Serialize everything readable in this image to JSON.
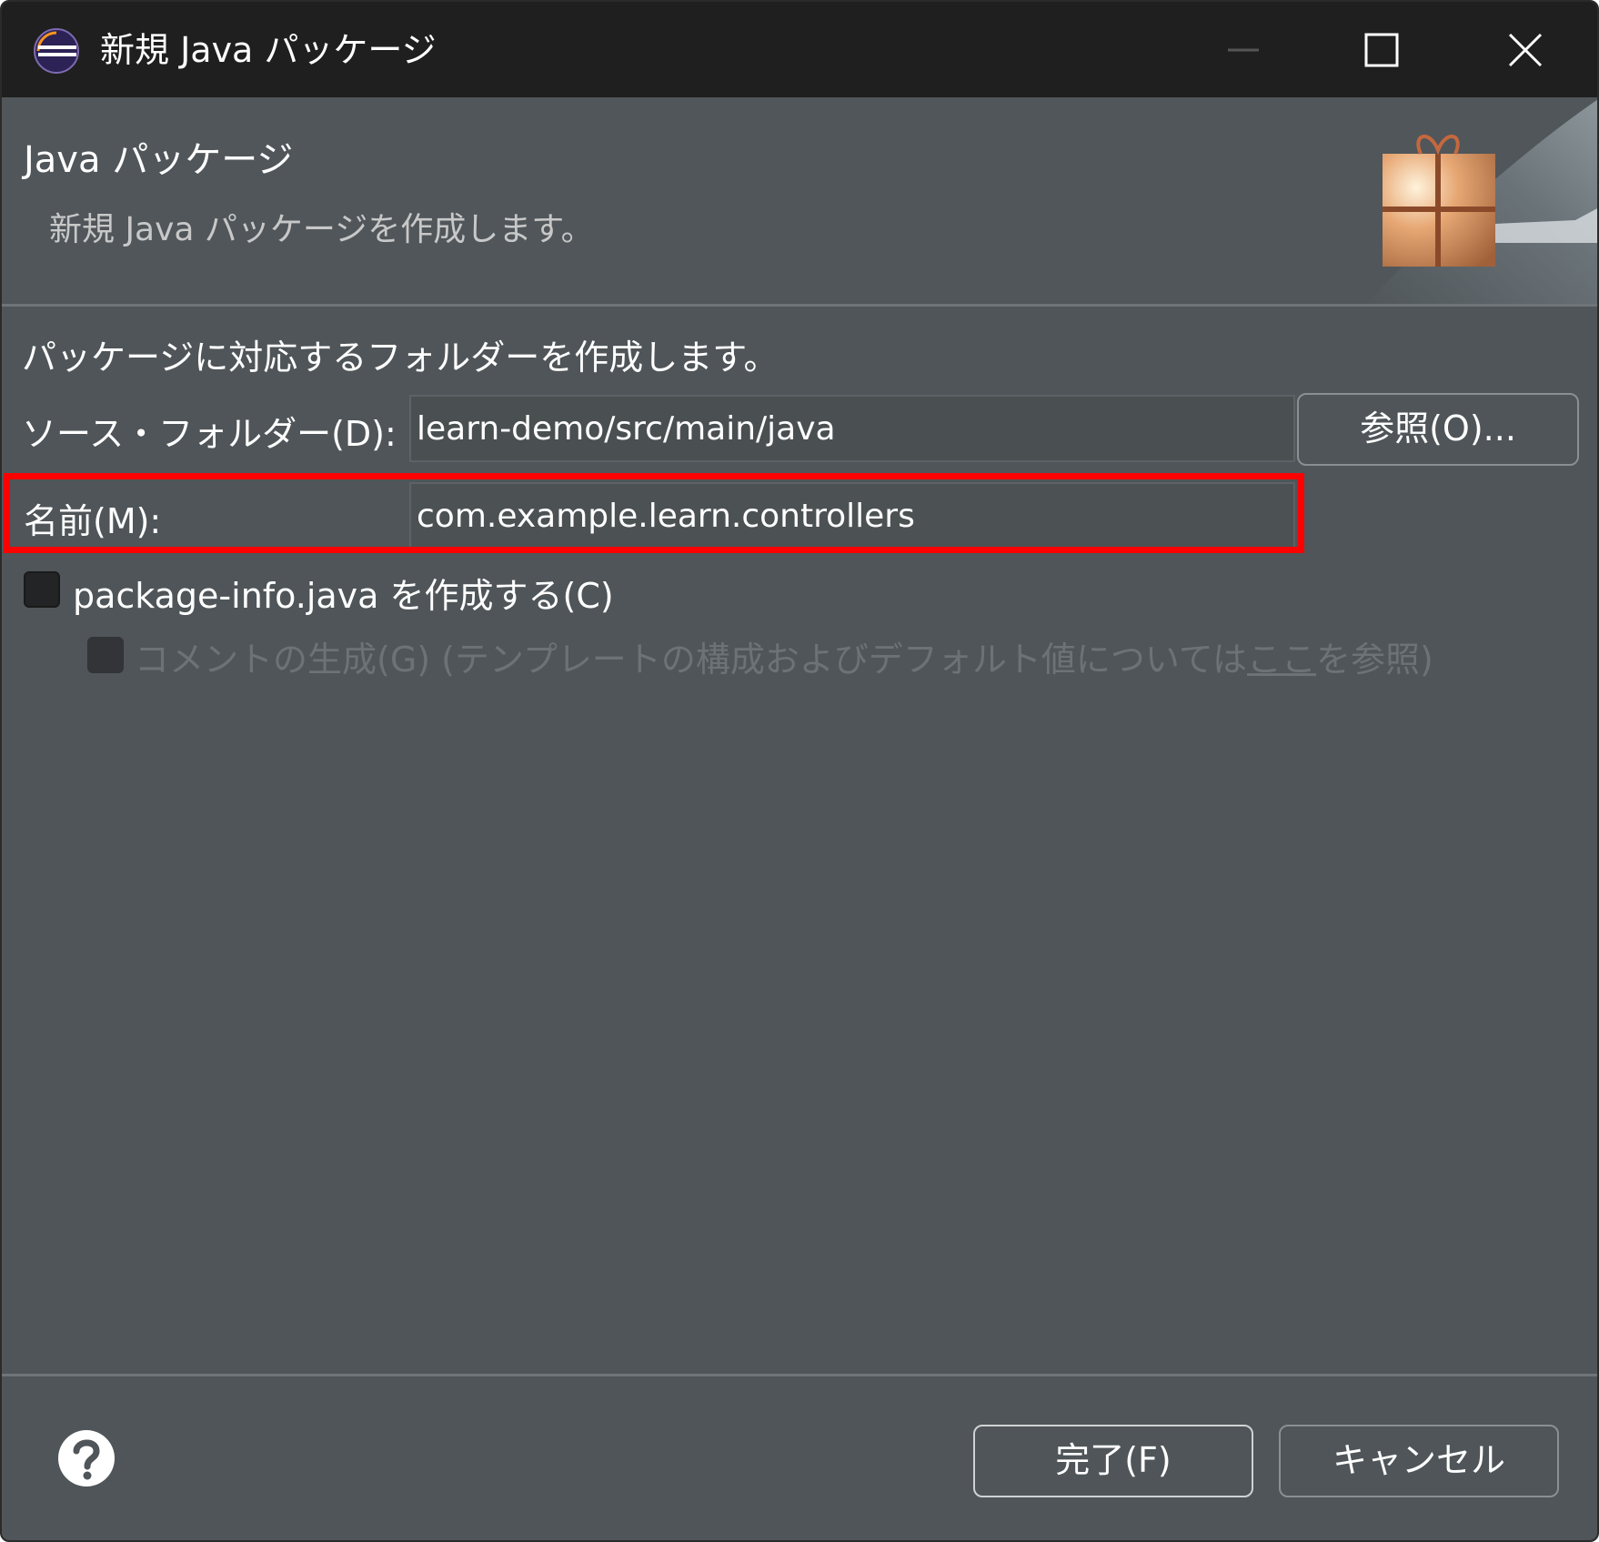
{
  "window": {
    "title": "新規 Java パッケージ"
  },
  "header": {
    "title": "Java パッケージ",
    "description": "新規 Java パッケージを作成します。"
  },
  "body": {
    "instruction": "パッケージに対応するフォルダーを作成します。",
    "source_folder": {
      "label": "ソース・フォルダー(D):",
      "value": "learn-demo/src/main/java",
      "browse_label": "参照(O)..."
    },
    "name": {
      "label": "名前(M):",
      "value": "com.example.learn.controllers"
    },
    "package_info_checkbox": {
      "label": "package-info.java を作成する(C)",
      "checked": false
    },
    "comment_checkbox": {
      "label_prefix": "コメントの生成(G) (テンプレートの構成およびデフォルト値については",
      "link": "ここ",
      "label_suffix": "を参照)",
      "checked": false,
      "enabled": false
    }
  },
  "footer": {
    "finish_label": "完了(F)",
    "cancel_label": "キャンセル"
  },
  "colors": {
    "titlebar": "#1f1f1f",
    "background": "#4f5558",
    "highlight": "#ff0000"
  },
  "icons": {
    "app": "eclipse-icon",
    "banner": "package-gift-icon",
    "help": "help-icon"
  }
}
